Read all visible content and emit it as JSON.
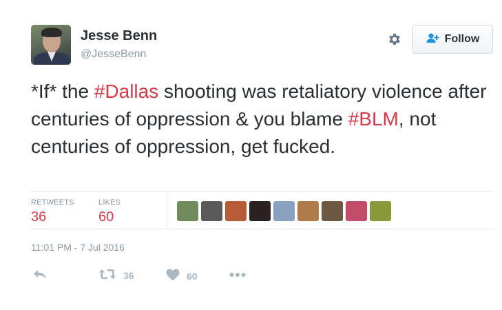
{
  "author": {
    "name": "Jesse Benn",
    "handle": "@JesseBenn"
  },
  "follow_button": {
    "label": "Follow",
    "icon": "add-user-icon"
  },
  "settings": {
    "icon": "gear-icon"
  },
  "tweet": {
    "text_parts": [
      {
        "text": "*If* the ",
        "hashtag": false
      },
      {
        "text": "#Dallas",
        "hashtag": true
      },
      {
        "text": " shooting was retaliatory violence after centuries of oppression & you blame ",
        "hashtag": false
      },
      {
        "text": "#BLM",
        "hashtag": true
      },
      {
        "text": ", not centuries of oppression, get fucked.",
        "hashtag": false
      }
    ]
  },
  "stats": {
    "retweets_label": "RETWEETS",
    "retweets_count": "36",
    "likes_label": "LIKES",
    "likes_count": "60",
    "liker_avatars": [
      {
        "icon": "liker-avatar-1",
        "color": "#6f8a5c"
      },
      {
        "icon": "liker-avatar-2",
        "color": "#5a5a5a"
      },
      {
        "icon": "liker-avatar-3",
        "color": "#b85a3a"
      },
      {
        "icon": "liker-avatar-4",
        "color": "#2a2320"
      },
      {
        "icon": "liker-avatar-5",
        "color": "#8aa0c0"
      },
      {
        "icon": "liker-avatar-6",
        "color": "#b07a4a"
      },
      {
        "icon": "liker-avatar-7",
        "color": "#6e5a44"
      },
      {
        "icon": "liker-avatar-8",
        "color": "#c34a6a"
      },
      {
        "icon": "liker-avatar-9",
        "color": "#8a9a3a"
      }
    ]
  },
  "timestamp": "11:01 PM - 7 Jul 2016",
  "actions": {
    "reply_icon": "reply-icon",
    "retweet_icon": "retweet-icon",
    "retweet_count": "36",
    "like_icon": "heart-icon",
    "like_count": "60",
    "more_icon": "more-icon"
  },
  "colors": {
    "hashtag": "#d63a4a",
    "muted": "#8899a6",
    "text": "#292f33"
  }
}
